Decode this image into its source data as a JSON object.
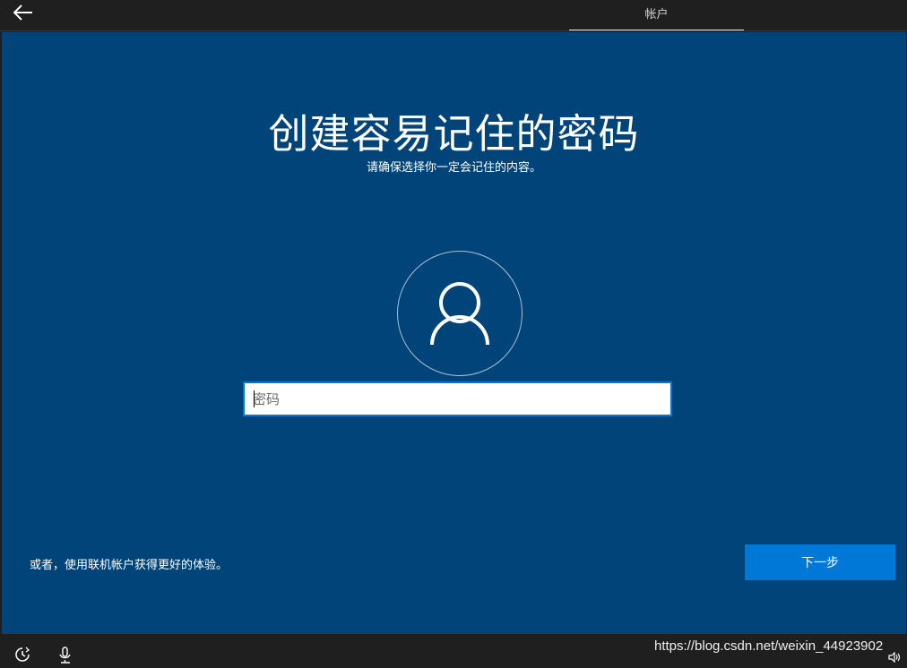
{
  "header": {
    "tab_label": "帐户"
  },
  "main": {
    "title": "创建容易记住的密码",
    "subtitle": "请确保选择你一定会记住的内容。",
    "password": {
      "placeholder": "密码",
      "value": ""
    },
    "online_account_link": "或者，使用联机帐户获得更好的体验。",
    "next_button": "下一步"
  },
  "footer": {
    "watermark": "https://blog.csdn.net/weixin_44923902"
  },
  "icons": {
    "back": "back-arrow-icon",
    "avatar": "user-icon",
    "ease_of_access": "ease-of-access-icon",
    "microphone": "microphone-icon",
    "volume": "volume-icon"
  },
  "colors": {
    "background": "#00447a",
    "accent": "#0078d7",
    "chrome": "#1f1f1f"
  }
}
